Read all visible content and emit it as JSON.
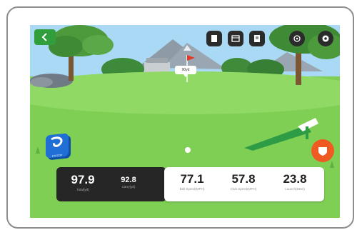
{
  "stats": {
    "primary": [
      {
        "value": "97.9",
        "label": "Total(yd)"
      },
      {
        "value": "92.8",
        "label": "Carry(yd)"
      }
    ],
    "secondary": [
      {
        "value": "77.1",
        "label": "Ball Speed(MPH)"
      },
      {
        "value": "57.8",
        "label": "Club Speed(MPH)"
      },
      {
        "value": "23.8",
        "label": "Launch(DEG)"
      }
    ]
  },
  "pin_tag": "90yd",
  "blue_logo_text": "EYECOP",
  "icons": {
    "back": "chevron-left-icon",
    "flag": "flag-icon",
    "scorecard": "scorecard-icon",
    "notes": "notes-icon",
    "camera": "camera-view-icon",
    "settings": "gear-icon"
  },
  "colors": {
    "grass": "#7fcf55",
    "sky": "#a9d9f5",
    "back_button": "#2f9e3b",
    "blue_logo": "#1f6fd6",
    "orange_logo": "#ef5a22"
  }
}
